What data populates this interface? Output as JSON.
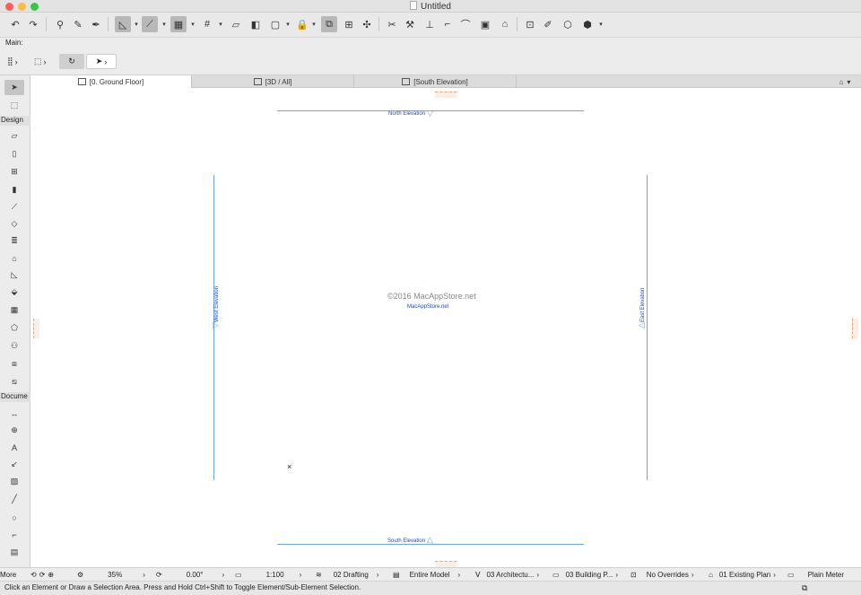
{
  "window": {
    "title": "Untitled",
    "colors": {
      "close": "#fc605c",
      "minimize": "#fdbc40",
      "zoom": "#34c84a"
    }
  },
  "infobox": {
    "label": "Main:"
  },
  "tabs": [
    {
      "label": "[0. Ground Floor]"
    },
    {
      "label": "[3D / All]"
    },
    {
      "label": "[South Elevation]"
    }
  ],
  "toolbox": {
    "design_label": "Design",
    "document_label": "Docume",
    "more_label": "More"
  },
  "canvas": {
    "north": "North Elevation",
    "south": "South Elevation",
    "west": "West Elevation",
    "east": "East Elevation",
    "watermark": "©2016 MacAppStore.net",
    "watermark_small": "MacAppStore.net",
    "accent": "#6aa6e8",
    "label_color": "#2244cc"
  },
  "status": {
    "zoom": "35%",
    "angle": "0.00°",
    "scale": "1:100",
    "layer_combo": "02 Drafting",
    "model_view": "Entire Model",
    "pen_set": "03 Architectu...",
    "mvo": "03 Building P...",
    "override": "No Overrides",
    "renovation": "01 Existing Plan",
    "dimension": "Plain Meter"
  },
  "hint": "Click an Element or Draw a Selection Area. Press and Hold Ctrl+Shift to Toggle Element/Sub-Element Selection."
}
